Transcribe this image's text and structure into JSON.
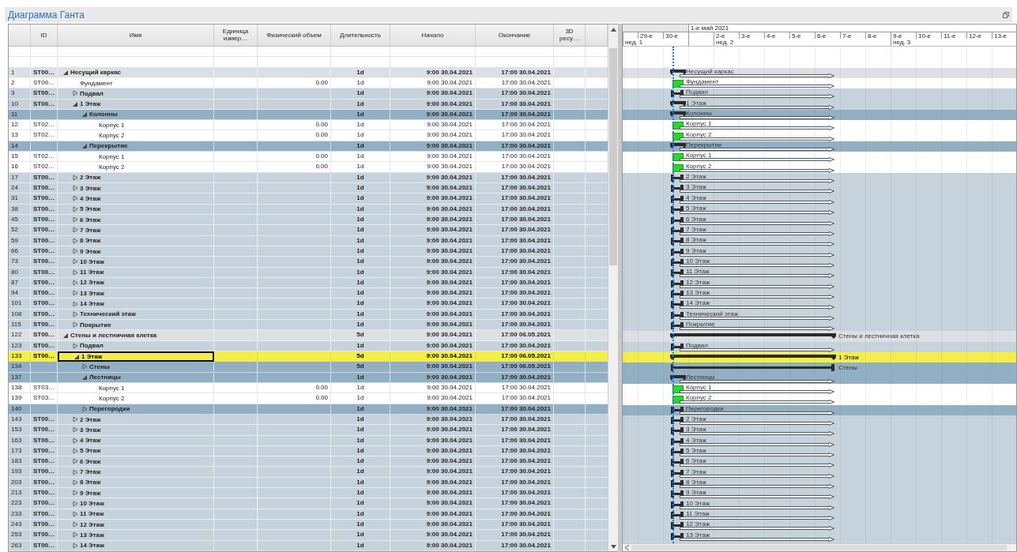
{
  "window": {
    "title": "Диаграмма Ганта"
  },
  "table": {
    "columns": [
      {
        "label": "ID"
      },
      {
        "label": "Имя"
      },
      {
        "label": "Единица измер…"
      },
      {
        "label": "Физический объем"
      },
      {
        "label": "Длительность"
      },
      {
        "label": "Начало"
      },
      {
        "label": "Окончание"
      },
      {
        "label": "3D ресу…"
      }
    ]
  },
  "timeline": {
    "days": [
      {
        "week": "нед. 1"
      },
      {
        "label": "29-е"
      },
      {
        "label": "30-е"
      },
      {
        "month": "1-е май 2021"
      },
      {
        "label": "2-е",
        "week": "нед. 2"
      },
      {
        "label": "3-е"
      },
      {
        "label": "4-е"
      },
      {
        "label": "5-е"
      },
      {
        "label": "6-е"
      },
      {
        "label": "7-е"
      },
      {
        "label": "8-е"
      },
      {
        "label": "9-е",
        "week": "нед. 3"
      },
      {
        "label": "10-е"
      },
      {
        "label": "11-е"
      },
      {
        "label": "12-е"
      },
      {
        "label": "13-е"
      }
    ]
  },
  "rows": [
    {
      "num": "1",
      "id": "ST00…",
      "name": "Несущий каркас",
      "kind": "summary",
      "expanded": true,
      "selected": false,
      "duration": "1d",
      "start": "9:00 30.04.2021",
      "end": "17:00 30.04.2021",
      "bar": {
        "kind": "summary",
        "label": "Несущий каркас"
      },
      "children": [
        {
          "num": "2",
          "id": "ST00…",
          "name": "Фундамент",
          "kind": "task",
          "selected": false,
          "volume": "0.00",
          "duration": "1d",
          "start": "9:00 30.04.2021",
          "end": "17:00 30.04.2021",
          "bar": {
            "kind": "task",
            "label": "Фундамент"
          }
        },
        {
          "num": "3",
          "id": "ST00…",
          "name": "Подвал",
          "kind": "group",
          "expanded": false,
          "selected": false,
          "duration": "1d",
          "start": "9:00 30.04.2021",
          "end": "17:00 30.04.2021",
          "bar": {
            "kind": "collapsed",
            "label": "Подвал"
          }
        },
        {
          "num": "10",
          "id": "ST00…",
          "name": "1 Этаж",
          "kind": "group",
          "expanded": true,
          "selected": false,
          "duration": "1d",
          "start": "9:00 30.04.2021",
          "end": "17:00 30.04.2021",
          "bar": {
            "kind": "summary",
            "label": "1 Этаж"
          },
          "children": [
            {
              "num": "11",
              "name": "Колонны",
              "kind": "subgroup",
              "expanded": true,
              "selected": false,
              "duration": "1d",
              "start": "9:00 30.04.2021",
              "end": "17:00 30.04.2021",
              "bar": {
                "kind": "summary",
                "label": "Колонны"
              },
              "children": [
                {
                  "num": "12",
                  "id": "ST02…",
                  "name": "Корпус 1",
                  "kind": "task",
                  "selected": false,
                  "volume": "0.00",
                  "duration": "1d",
                  "start": "9:00 30.04.2021",
                  "end": "17:00 30.04.2021",
                  "bar": {
                    "kind": "task",
                    "label": "Корпус 1"
                  }
                },
                {
                  "num": "13",
                  "id": "ST02…",
                  "name": "Корпус 2",
                  "kind": "task",
                  "selected": false,
                  "volume": "0.00",
                  "duration": "1d",
                  "start": "9:00 30.04.2021",
                  "end": "17:00 30.04.2021",
                  "bar": {
                    "kind": "task",
                    "label": "Корпус 2"
                  }
                }
              ]
            },
            {
              "num": "14",
              "name": "Перекрытие",
              "kind": "subgroup",
              "expanded": true,
              "selected": false,
              "duration": "1d",
              "start": "9:00 30.04.2021",
              "end": "17:00 30.04.2021",
              "bar": {
                "kind": "summary",
                "label": "Перекрытие"
              },
              "children": [
                {
                  "num": "15",
                  "id": "ST02…",
                  "name": "Корпус 1",
                  "kind": "task",
                  "selected": false,
                  "volume": "0.00",
                  "duration": "1d",
                  "start": "9:00 30.04.2021",
                  "end": "17:00 30.04.2021",
                  "bar": {
                    "kind": "task",
                    "label": "Корпус 1"
                  }
                },
                {
                  "num": "16",
                  "id": "ST02…",
                  "name": "Корпус 2",
                  "kind": "task",
                  "selected": false,
                  "volume": "0.00",
                  "duration": "1d",
                  "start": "9:00 30.04.2021",
                  "end": "17:00 30.04.2021",
                  "bar": {
                    "kind": "task",
                    "label": "Корпус 2"
                  }
                }
              ]
            }
          ]
        },
        {
          "num": "17",
          "id": "ST00…",
          "name": "2 Этаж",
          "kind": "group",
          "expanded": false,
          "selected": false,
          "duration": "1d",
          "start": "9:00 30.04.2021",
          "end": "17:00 30.04.2021",
          "bar": {
            "kind": "collapsed",
            "label": "2 Этаж"
          }
        },
        {
          "num": "24",
          "id": "ST00…",
          "name": "3 Этаж",
          "kind": "group",
          "expanded": false,
          "selected": false,
          "duration": "1d",
          "start": "9:00 30.04.2021",
          "end": "17:00 30.04.2021",
          "bar": {
            "kind": "collapsed",
            "label": "3 Этаж"
          }
        },
        {
          "num": "31",
          "id": "ST00…",
          "name": "4 Этаж",
          "kind": "group",
          "expanded": false,
          "selected": false,
          "duration": "1d",
          "start": "9:00 30.04.2021",
          "end": "17:00 30.04.2021",
          "bar": {
            "kind": "collapsed",
            "label": "4 Этаж"
          }
        },
        {
          "num": "38",
          "id": "ST00…",
          "name": "5 Этаж",
          "kind": "group",
          "expanded": false,
          "selected": false,
          "duration": "1d",
          "start": "9:00 30.04.2021",
          "end": "17:00 30.04.2021",
          "bar": {
            "kind": "collapsed",
            "label": "5 Этаж"
          }
        },
        {
          "num": "45",
          "id": "ST00…",
          "name": "6 Этаж",
          "kind": "group",
          "expanded": false,
          "selected": false,
          "duration": "1d",
          "start": "9:00 30.04.2021",
          "end": "17:00 30.04.2021",
          "bar": {
            "kind": "collapsed",
            "label": "6 Этаж"
          }
        },
        {
          "num": "52",
          "id": "ST00…",
          "name": "7 Этаж",
          "kind": "group",
          "expanded": false,
          "selected": false,
          "duration": "1d",
          "start": "9:00 30.04.2021",
          "end": "17:00 30.04.2021",
          "bar": {
            "kind": "collapsed",
            "label": "7 Этаж"
          }
        },
        {
          "num": "59",
          "id": "ST00…",
          "name": "8 Этаж",
          "kind": "group",
          "expanded": false,
          "selected": false,
          "duration": "1d",
          "start": "9:00 30.04.2021",
          "end": "17:00 30.04.2021",
          "bar": {
            "kind": "collapsed",
            "label": "8 Этаж"
          }
        },
        {
          "num": "66",
          "id": "ST00…",
          "name": "9 Этаж",
          "kind": "group",
          "expanded": false,
          "selected": false,
          "duration": "1d",
          "start": "9:00 30.04.2021",
          "end": "17:00 30.04.2021",
          "bar": {
            "kind": "collapsed",
            "label": "9 Этаж"
          }
        },
        {
          "num": "73",
          "id": "ST00…",
          "name": "10 Этаж",
          "kind": "group",
          "expanded": false,
          "selected": false,
          "duration": "1d",
          "start": "9:00 30.04.2021",
          "end": "17:00 30.04.2021",
          "bar": {
            "kind": "collapsed",
            "label": "10 Этаж"
          }
        },
        {
          "num": "80",
          "id": "ST00…",
          "name": "11 Этаж",
          "kind": "group",
          "expanded": false,
          "selected": false,
          "duration": "1d",
          "start": "9:00 30.04.2021",
          "end": "17:00 30.04.2021",
          "bar": {
            "kind": "collapsed",
            "label": "11 Этаж"
          }
        },
        {
          "num": "87",
          "id": "ST00…",
          "name": "12 Этаж",
          "kind": "group",
          "expanded": false,
          "selected": false,
          "duration": "1d",
          "start": "9:00 30.04.2021",
          "end": "17:00 30.04.2021",
          "bar": {
            "kind": "collapsed",
            "label": "12 Этаж"
          }
        },
        {
          "num": "94",
          "id": "ST00…",
          "name": "13 Этаж",
          "kind": "group",
          "expanded": false,
          "selected": false,
          "duration": "1d",
          "start": "9:00 30.04.2021",
          "end": "17:00 30.04.2021",
          "bar": {
            "kind": "collapsed",
            "label": "13 Этаж"
          }
        },
        {
          "num": "101",
          "id": "ST00…",
          "name": "14 Этаж",
          "kind": "group",
          "expanded": false,
          "selected": false,
          "duration": "1d",
          "start": "9:00 30.04.2021",
          "end": "17:00 30.04.2021",
          "bar": {
            "kind": "collapsed",
            "label": "14 Этаж"
          }
        },
        {
          "num": "108",
          "id": "ST00…",
          "name": "Технический этаж",
          "kind": "group",
          "expanded": false,
          "selected": false,
          "duration": "1d",
          "start": "9:00 30.04.2021",
          "end": "17:00 30.04.2021",
          "bar": {
            "kind": "collapsed",
            "label": "Технический этаж"
          }
        },
        {
          "num": "115",
          "id": "ST00…",
          "name": "Покрытие",
          "kind": "group",
          "expanded": false,
          "selected": false,
          "duration": "1d",
          "start": "9:00 30.04.2021",
          "end": "17:00 30.04.2021",
          "bar": {
            "kind": "collapsed",
            "label": "Покрытие"
          }
        }
      ]
    },
    {
      "num": "122",
      "id": "ST00…",
      "name": "Стены и лестничная клетка",
      "kind": "summary",
      "expanded": true,
      "selected": false,
      "duration": "5d",
      "start": "9:00 30.04.2021",
      "end": "17:00 06.05.2021",
      "bar": {
        "kind": "summary-long",
        "label": "Стены и лестничная клетка"
      },
      "children": [
        {
          "num": "123",
          "id": "ST00…",
          "name": "Подвал",
          "kind": "group",
          "expanded": false,
          "selected": false,
          "duration": "1d",
          "start": "9:00 30.04.2021",
          "end": "17:00 30.04.2021",
          "bar": {
            "kind": "collapsed",
            "label": "Подвал"
          }
        },
        {
          "num": "133",
          "id": "ST00…",
          "name": "1 Этаж",
          "kind": "group",
          "expanded": true,
          "selected": true,
          "duration": "5d",
          "start": "9:00 30.04.2021",
          "end": "17:00 06.05.2021",
          "bar": {
            "kind": "summary-long",
            "label": "1 Этаж"
          },
          "children": [
            {
              "num": "134",
              "name": "Стены",
              "kind": "subgroup",
              "expanded": false,
              "selected": false,
              "duration": "5d",
              "start": "9:00 30.04.2021",
              "end": "17:00 06.05.2021",
              "bar": {
                "kind": "collapsed-long",
                "label": "Стены"
              }
            },
            {
              "num": "137",
              "name": "Лестницы",
              "kind": "subgroup",
              "expanded": true,
              "selected": false,
              "duration": "1d",
              "start": "9:00 30.04.2021",
              "end": "17:00 30.04.2021",
              "bar": {
                "kind": "summary",
                "label": "Лестницы"
              },
              "children": [
                {
                  "num": "138",
                  "id": "ST03…",
                  "name": "Корпус 1",
                  "kind": "task",
                  "selected": false,
                  "volume": "0.00",
                  "duration": "1d",
                  "start": "9:00 30.04.2021",
                  "end": "17:00 30.04.2021",
                  "bar": {
                    "kind": "task",
                    "label": "Корпус 1"
                  }
                },
                {
                  "num": "139",
                  "id": "ST03…",
                  "name": "Корпус 2",
                  "kind": "task",
                  "selected": false,
                  "volume": "0.00",
                  "duration": "1d",
                  "start": "9:00 30.04.2021",
                  "end": "17:00 30.04.2021",
                  "bar": {
                    "kind": "task",
                    "label": "Корпус 2"
                  }
                }
              ]
            },
            {
              "num": "140",
              "name": "Перегородки",
              "kind": "subgroup",
              "expanded": false,
              "selected": false,
              "duration": "1d",
              "start": "9:00 30.04.2021",
              "end": "17:00 30.04.2021",
              "bar": {
                "kind": "collapsed",
                "label": "Перегородки"
              }
            }
          ]
        },
        {
          "num": "143",
          "id": "ST00…",
          "name": "2 Этаж",
          "kind": "group",
          "expanded": false,
          "selected": false,
          "duration": "1d",
          "start": "9:00 30.04.2021",
          "end": "17:00 30.04.2021",
          "bar": {
            "kind": "collapsed",
            "label": "2 Этаж"
          }
        },
        {
          "num": "153",
          "id": "ST00…",
          "name": "3 Этаж",
          "kind": "group",
          "expanded": false,
          "selected": false,
          "duration": "1d",
          "start": "9:00 30.04.2021",
          "end": "17:00 30.04.2021",
          "bar": {
            "kind": "collapsed",
            "label": "3 Этаж"
          }
        },
        {
          "num": "163",
          "id": "ST00…",
          "name": "4 Этаж",
          "kind": "group",
          "expanded": false,
          "selected": false,
          "duration": "1d",
          "start": "9:00 30.04.2021",
          "end": "17:00 30.04.2021",
          "bar": {
            "kind": "collapsed",
            "label": "4 Этаж"
          }
        },
        {
          "num": "173",
          "id": "ST00…",
          "name": "5 Этаж",
          "kind": "group",
          "expanded": false,
          "selected": false,
          "duration": "1d",
          "start": "9:00 30.04.2021",
          "end": "17:00 30.04.2021",
          "bar": {
            "kind": "collapsed",
            "label": "5 Этаж"
          }
        },
        {
          "num": "183",
          "id": "ST00…",
          "name": "6 Этаж",
          "kind": "group",
          "expanded": false,
          "selected": false,
          "duration": "1d",
          "start": "9:00 30.04.2021",
          "end": "17:00 30.04.2021",
          "bar": {
            "kind": "collapsed",
            "label": "6 Этаж"
          }
        },
        {
          "num": "193",
          "id": "ST00…",
          "name": "7 Этаж",
          "kind": "group",
          "expanded": false,
          "selected": false,
          "duration": "1d",
          "start": "9:00 30.04.2021",
          "end": "17:00 30.04.2021",
          "bar": {
            "kind": "collapsed",
            "label": "7 Этаж"
          }
        },
        {
          "num": "203",
          "id": "ST00…",
          "name": "8 Этаж",
          "kind": "group",
          "expanded": false,
          "selected": false,
          "duration": "1d",
          "start": "9:00 30.04.2021",
          "end": "17:00 30.04.2021",
          "bar": {
            "kind": "collapsed",
            "label": "8 Этаж"
          }
        },
        {
          "num": "213",
          "id": "ST00…",
          "name": "9 Этаж",
          "kind": "group",
          "expanded": false,
          "selected": false,
          "duration": "1d",
          "start": "9:00 30.04.2021",
          "end": "17:00 30.04.2021",
          "bar": {
            "kind": "collapsed",
            "label": "9 Этаж"
          }
        },
        {
          "num": "223",
          "id": "ST00…",
          "name": "10 Этаж",
          "kind": "group",
          "expanded": false,
          "selected": false,
          "duration": "1d",
          "start": "9:00 30.04.2021",
          "end": "17:00 30.04.2021",
          "bar": {
            "kind": "collapsed",
            "label": "10 Этаж"
          }
        },
        {
          "num": "233",
          "id": "ST00…",
          "name": "11 Этаж",
          "kind": "group",
          "expanded": false,
          "selected": false,
          "duration": "1d",
          "start": "9:00 30.04.2021",
          "end": "17:00 30.04.2021",
          "bar": {
            "kind": "collapsed",
            "label": "11 Этаж"
          }
        },
        {
          "num": "243",
          "id": "ST00…",
          "name": "12 Этаж",
          "kind": "group",
          "expanded": false,
          "selected": false,
          "duration": "1d",
          "start": "9:00 30.04.2021",
          "end": "17:00 30.04.2021",
          "bar": {
            "kind": "collapsed",
            "label": "12 Этаж"
          }
        },
        {
          "num": "253",
          "id": "ST00…",
          "name": "13 Этаж",
          "kind": "group",
          "expanded": false,
          "selected": false,
          "duration": "1d",
          "start": "9:00 30.04.2021",
          "end": "17:00 30.04.2021",
          "bar": {
            "kind": "collapsed",
            "label": "13 Этаж"
          }
        },
        {
          "num": "263",
          "id": "ST00…",
          "name": "14 Этаж",
          "kind": "group",
          "expanded": false,
          "selected": false,
          "duration": "1d",
          "start": "9:00 30.04.2021",
          "end": "17:00 30.04.2021"
        }
      ]
    }
  ]
}
